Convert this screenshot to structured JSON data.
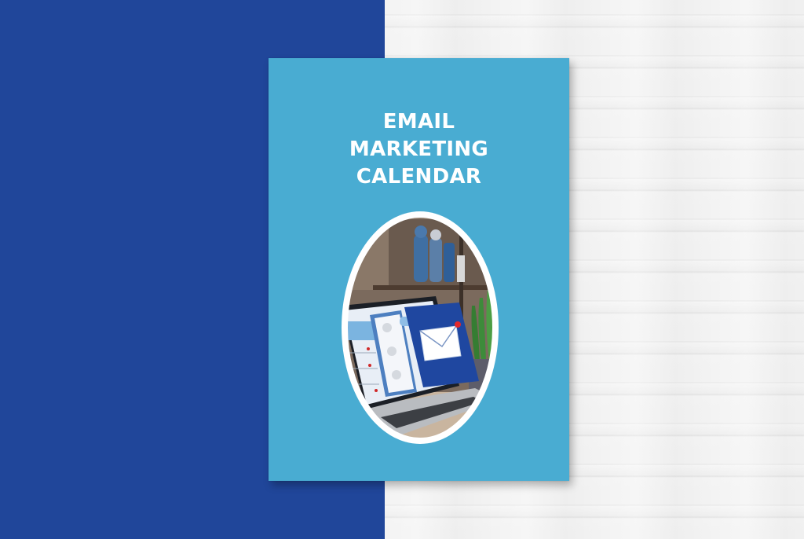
{
  "cover": {
    "title_lines": [
      "EMAIL",
      "MARKETING",
      "CALENDAR"
    ],
    "background_color": "#49acd2"
  },
  "backdrop": {
    "left_color": "#20469a",
    "right_texture": "white-wood"
  },
  "illustration": {
    "subject": "laptop-with-email-notification",
    "icons": [
      "envelope-icon",
      "user-icon",
      "notification-badge"
    ]
  }
}
